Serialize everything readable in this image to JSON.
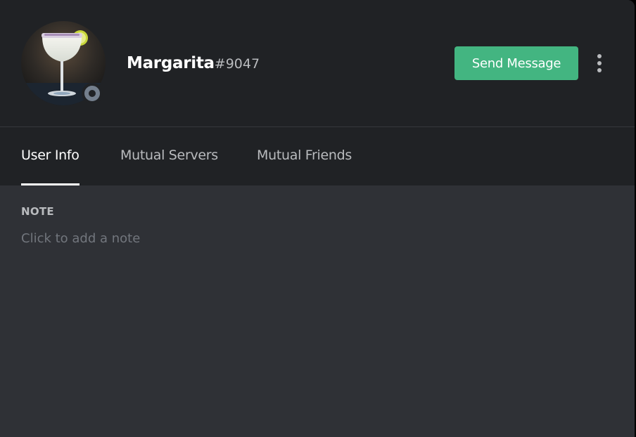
{
  "profile": {
    "username": "Margarita",
    "discriminator": "#9047",
    "avatar_icon": "margarita-cocktail-avatar",
    "status_icon": "offline-status-icon",
    "status_color": "#747f8d"
  },
  "actions": {
    "send_message_label": "Send Message",
    "send_message_color": "#43b581",
    "more_icon": "more-vertical-icon"
  },
  "tabs": [
    {
      "label": "User Info",
      "active": true
    },
    {
      "label": "Mutual Servers",
      "active": false
    },
    {
      "label": "Mutual Friends",
      "active": false
    }
  ],
  "note": {
    "title": "NOTE",
    "placeholder": "Click to add a note"
  },
  "theme": {
    "header_bg": "#202225",
    "body_bg": "#2f3136",
    "text_primary": "#ffffff",
    "text_muted": "#b9bbbe",
    "placeholder": "#72767d"
  }
}
